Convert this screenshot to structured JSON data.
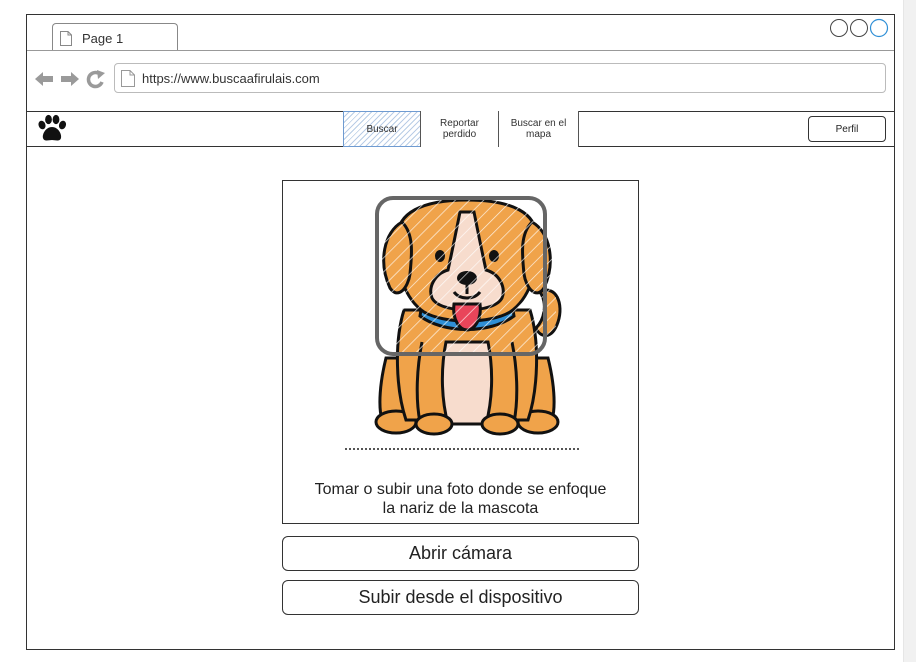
{
  "browser": {
    "tab_title": "Page 1",
    "url": "https://www.buscaafirulais.com"
  },
  "nav": {
    "logo_icon": "paw-icon",
    "items": [
      {
        "label_line1": "Buscar",
        "label_line2": "",
        "active": true
      },
      {
        "label_line1": "Reportar",
        "label_line2": "perdido",
        "active": false
      },
      {
        "label_line1": "Buscar en el",
        "label_line2": "mapa",
        "active": false
      }
    ],
    "profile_label": "Perfil"
  },
  "main": {
    "image_icon": "dog-icon",
    "instruction_line1": "Tomar o subir una foto donde se enfoque",
    "instruction_line2": "la nariz de la mascota",
    "open_camera_label": "Abrir cámara",
    "upload_label": "Subir desde el dispositivo"
  },
  "colors": {
    "dog_fur": "#f0a34a",
    "dog_light": "#f7dccd",
    "focus_frame": "#666666",
    "collar": "#2f8fd6",
    "tongue": "#e9455a",
    "active_tab": "#b9cde6"
  }
}
